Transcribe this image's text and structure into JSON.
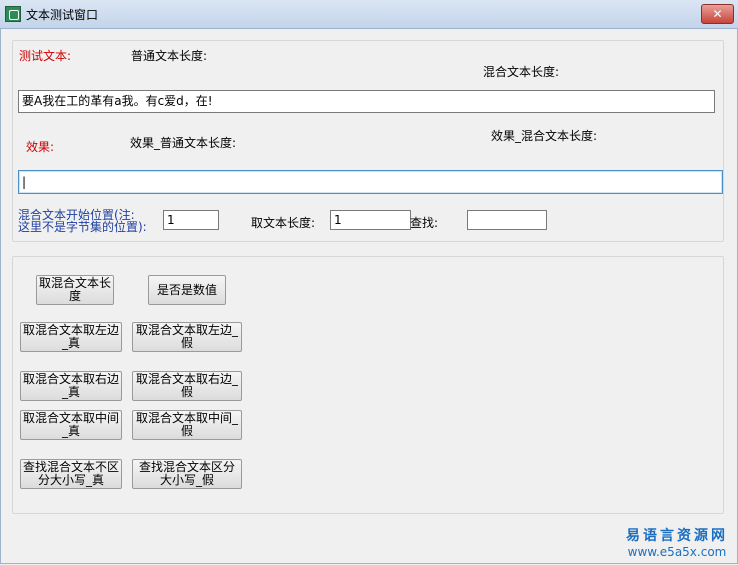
{
  "window": {
    "title": "文本测试窗口",
    "close": "✕"
  },
  "top": {
    "test_label": "测试文本:",
    "normal_len_label": "普通文本长度:",
    "mixed_len_label": "混合文本长度:",
    "test_text": "要A我在工的革有a我。有c爱d，在!",
    "effect_label": "效果:",
    "effect_normal_len_label": "效果_普通文本长度:",
    "effect_mixed_len_label": "效果_混合文本长度:",
    "effect_text": "|",
    "start_pos_label_1": "混合文本开始位置(注:",
    "start_pos_label_2": "这里不是字节集的位置):",
    "start_pos_value": "1",
    "take_len_label": "取文本长度:",
    "take_len_value": "1",
    "find_label": "查找:",
    "find_value": ""
  },
  "buttons": {
    "mixed_len": "取混合文本长度",
    "is_numeric": "是否是数值",
    "left_true": "取混合文本取左边_真",
    "left_false": "取混合文本取左边_假",
    "right_true": "取混合文本取右边_真",
    "right_false": "取混合文本取右边_假",
    "mid_true": "取混合文本取中间_真",
    "mid_false": "取混合文本取中间_假",
    "find_insensitive": "查找混合文本不区分大小写_真",
    "find_sensitive": "查找混合文本区分大小写_假"
  },
  "watermark": {
    "line1": "易语言资源网",
    "line2": "www.e5a5x.com"
  }
}
